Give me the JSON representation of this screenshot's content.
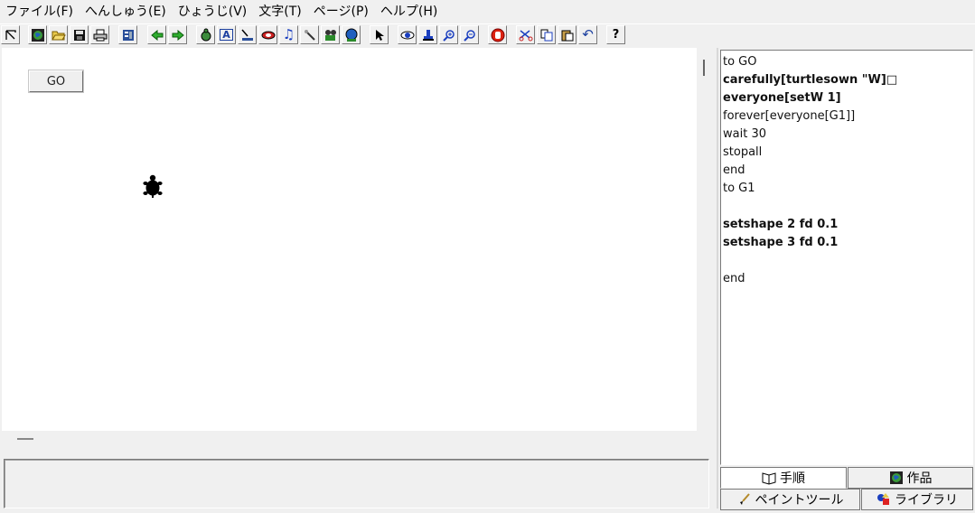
{
  "menu": [
    "ファイル(F)",
    "へんしゅう(E)",
    "ひょうじ(V)",
    "文字(T)",
    "ページ(P)",
    "ヘルプ(H)"
  ],
  "toolbar": [
    {
      "name": "pointer-arrow-icon",
      "glyph": "↸"
    },
    {
      "name": "globe-icon",
      "glyph": ""
    },
    {
      "name": "open-folder-icon",
      "glyph": ""
    },
    {
      "name": "save-disk-icon",
      "glyph": ""
    },
    {
      "name": "print-icon",
      "glyph": ""
    },
    {
      "name": "page-sorter-icon",
      "glyph": ""
    },
    {
      "name": "previous-page-icon",
      "glyph": ""
    },
    {
      "name": "next-page-icon",
      "glyph": ""
    },
    {
      "name": "new-turtle-icon",
      "glyph": ""
    },
    {
      "name": "new-text-icon",
      "glyph": "A"
    },
    {
      "name": "new-slider-icon",
      "glyph": ""
    },
    {
      "name": "new-button-icon",
      "glyph": ""
    },
    {
      "name": "melody-icon",
      "glyph": "♫"
    },
    {
      "name": "magic-wand-icon",
      "glyph": ""
    },
    {
      "name": "video-camera-icon",
      "glyph": ""
    },
    {
      "name": "web-icon",
      "glyph": ""
    },
    {
      "name": "select-arrow-icon",
      "glyph": ""
    },
    {
      "name": "eye-icon",
      "glyph": ""
    },
    {
      "name": "stamp-icon",
      "glyph": ""
    },
    {
      "name": "zoom-in-icon",
      "glyph": ""
    },
    {
      "name": "zoom-out-icon",
      "glyph": ""
    },
    {
      "name": "stop-hand-icon",
      "glyph": ""
    },
    {
      "name": "cut-scissors-icon",
      "glyph": ""
    },
    {
      "name": "copy-icon",
      "glyph": ""
    },
    {
      "name": "paste-icon",
      "glyph": ""
    },
    {
      "name": "undo-icon",
      "glyph": "↶"
    },
    {
      "name": "help-icon",
      "glyph": "?"
    }
  ],
  "canvas": {
    "go_label": "GO"
  },
  "procedures": {
    "lines": [
      {
        "text": "to GO",
        "bold": false
      },
      {
        "text": "carefully[turtlesown \"W]□",
        "bold": true
      },
      {
        "text": "everyone[setW 1]",
        "bold": true
      },
      {
        "text": "forever[everyone[G1]]",
        "bold": false
      },
      {
        "text": "wait 30",
        "bold": false
      },
      {
        "text": "stopall",
        "bold": false
      },
      {
        "text": "end",
        "bold": false
      },
      {
        "text": "to G1",
        "bold": false
      },
      {
        "text": "",
        "bold": false
      },
      {
        "text": "setshape 2 fd 0.1",
        "bold": true
      },
      {
        "text": "setshape 3 fd 0.1",
        "bold": true
      },
      {
        "text": "",
        "bold": false
      },
      {
        "text": "end",
        "bold": false
      }
    ]
  },
  "tabs": {
    "procedures_label": "手順",
    "projects_label": "作品",
    "paint_label": "ペイントツール",
    "library_label": "ライブラリ"
  }
}
